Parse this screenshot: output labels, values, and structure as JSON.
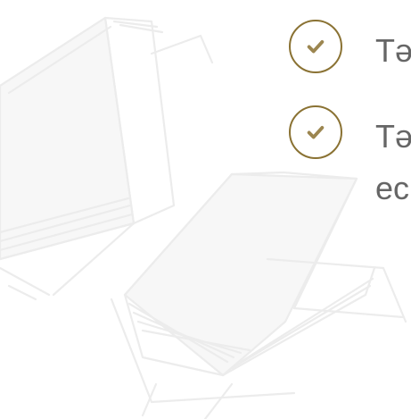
{
  "theme": {
    "accent": "#8a7233",
    "check_color": "#9c8650",
    "text_color": "#666666"
  },
  "background": {
    "icon": "open-books-illustration"
  },
  "checklist": {
    "items": [
      {
        "icon": "check-icon",
        "text_line1": "Tə",
        "text_line2": ""
      },
      {
        "icon": "check-icon",
        "text_line1": "Tə",
        "text_line2": "ec"
      }
    ]
  }
}
